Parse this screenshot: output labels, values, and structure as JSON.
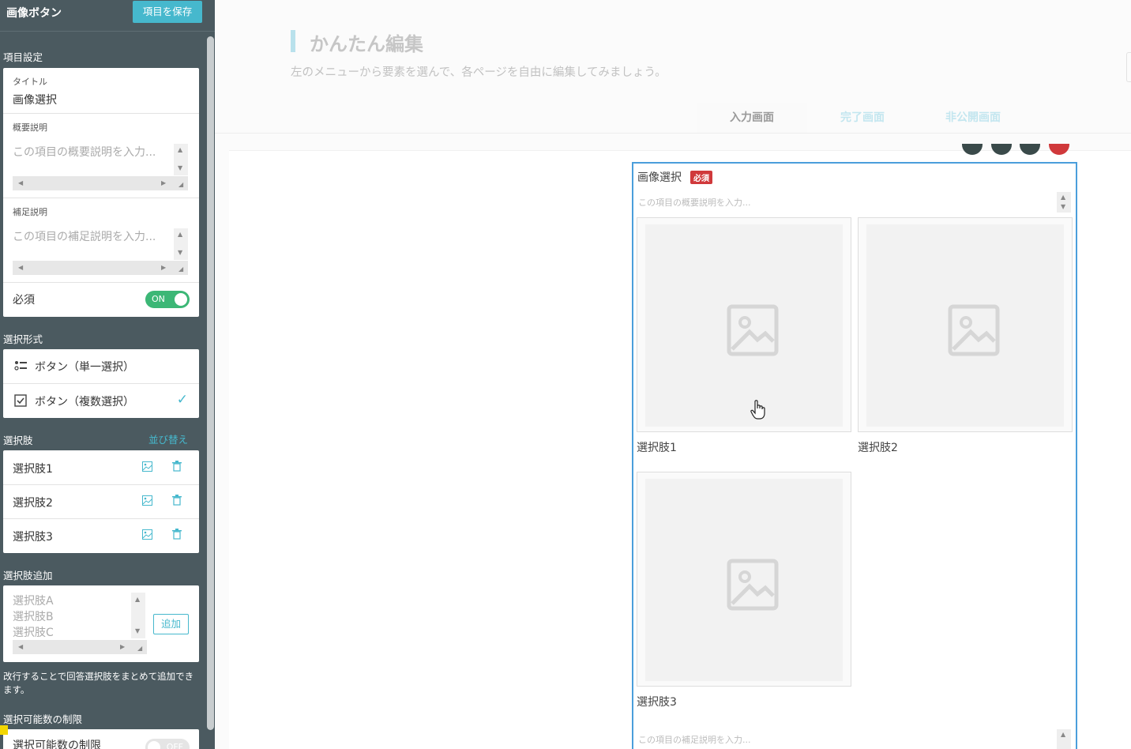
{
  "sidebar": {
    "title": "画像ボタン",
    "save_label": "項目を保存",
    "item_settings": {
      "section_label": "項目設定",
      "title_label": "タイトル",
      "title_value": "画像選択",
      "summary_label": "概要説明",
      "summary_placeholder": "この項目の概要説明を入力...",
      "supplement_label": "補足説明",
      "supplement_placeholder": "この項目の補足説明を入力...",
      "required_label": "必須",
      "required_toggle": "ON"
    },
    "selection_format": {
      "section_label": "選択形式",
      "options": [
        {
          "label": "ボタン（単一選択）",
          "icon": "list-icon",
          "selected": false
        },
        {
          "label": "ボタン（複数選択）",
          "icon": "checkbox-icon",
          "selected": true
        }
      ]
    },
    "choices": {
      "section_label": "選択肢",
      "sort_label": "並び替え",
      "items": [
        {
          "label": "選択肢1"
        },
        {
          "label": "選択肢2"
        },
        {
          "label": "選択肢3"
        }
      ]
    },
    "add_choices": {
      "section_label": "選択肢追加",
      "placeholder_lines": [
        "選択肢A",
        "選択肢B",
        "選択肢C"
      ],
      "add_label": "追加",
      "note": "改行することで回答選択肢をまとめて追加できます。"
    },
    "limit": {
      "section_label": "選択可能数の制限",
      "row_label": "選択可能数の制限",
      "toggle": "OFF"
    }
  },
  "main": {
    "title": "かんたん編集",
    "description": "左のメニューから要素を選んで、各ページを自由に編集してみましょう。",
    "tabs": [
      {
        "label": "入力画面",
        "active": true
      },
      {
        "label": "完了画面",
        "active": false
      },
      {
        "label": "非公開画面",
        "active": false
      }
    ],
    "item": {
      "title": "画像選択",
      "required_badge": "必須",
      "summary_placeholder": "この項目の概要説明を入力...",
      "supplement_placeholder": "この項目の補足説明を入力...",
      "choices": [
        {
          "label": "選択肢1"
        },
        {
          "label": "選択肢2"
        },
        {
          "label": "選択肢3"
        }
      ]
    }
  },
  "colors": {
    "sidebar_bg": "#4b5a60",
    "accent": "#46b8cd",
    "toggle_on": "#3cb776",
    "required_badge": "#d0393b",
    "selected_border": "#4a9edb"
  }
}
